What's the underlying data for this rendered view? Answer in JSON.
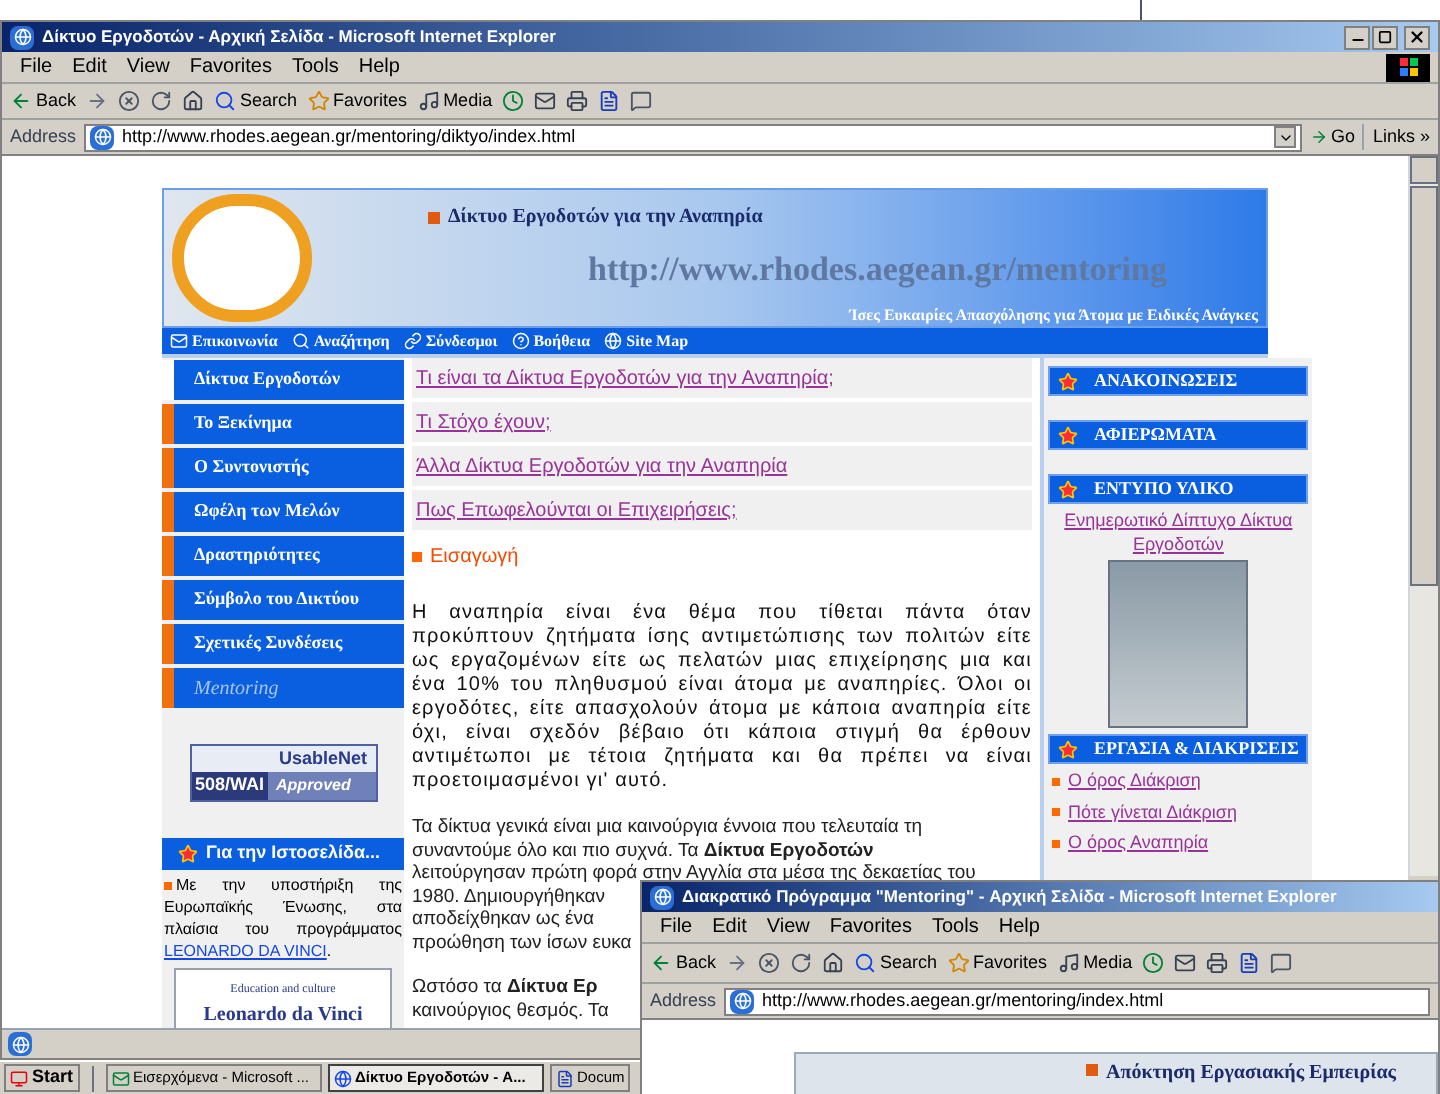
{
  "main_window": {
    "title": "Δίκτυο Εργοδοτών - Αρχική Σελίδα - Microsoft Internet Explorer",
    "menu": [
      "File",
      "Edit",
      "View",
      "Favorites",
      "Tools",
      "Help"
    ],
    "toolbar": [
      {
        "kind": "back",
        "label": "Back"
      },
      {
        "kind": "forward"
      },
      {
        "kind": "stop"
      },
      {
        "kind": "refresh"
      },
      {
        "kind": "home"
      },
      {
        "kind": "search",
        "label": "Search"
      },
      {
        "kind": "favorites",
        "label": "Favorites"
      },
      {
        "kind": "media",
        "label": "Media"
      },
      {
        "kind": "history"
      },
      {
        "kind": "mail"
      },
      {
        "kind": "print"
      },
      {
        "kind": "edit"
      },
      {
        "kind": "discuss"
      }
    ],
    "address": {
      "label": "Address",
      "value": "http://www.rhodes.aegean.gr/mentoring/diktyo/index.html"
    },
    "go": "Go",
    "links": "Links »"
  },
  "page": {
    "header": {
      "title": "Δίκτυο Εργοδοτών για την Αναπηρία",
      "url": "http://www.rhodes.aegean.gr/mentoring",
      "slogan": "Ίσες Ευκαιρίες Απασχόλησης για Άτομα με Ειδικές Ανάγκες"
    },
    "nav": [
      {
        "kind": "mail",
        "label": "Επικοινωνία"
      },
      {
        "kind": "search",
        "label": "Αναζήτηση"
      },
      {
        "kind": "links",
        "label": "Σύνδεσμοι"
      },
      {
        "kind": "help",
        "label": "Βοήθεια"
      },
      {
        "kind": "globe",
        "label": "Site Map"
      }
    ],
    "left_menu": [
      {
        "label": "Δίκτυα Εργοδοτών",
        "selected": true,
        "kind": "normal"
      },
      {
        "label": "Το Ξεκίνημα",
        "selected": false,
        "kind": "normal"
      },
      {
        "label": "Ο Συντονιστής",
        "selected": false,
        "kind": "normal"
      },
      {
        "label": "Ωφέλη των Μελών",
        "selected": false,
        "kind": "normal"
      },
      {
        "label": "Δραστηριότητες",
        "selected": false,
        "kind": "normal"
      },
      {
        "label": "Σύμβολο του Δικτύου",
        "selected": false,
        "kind": "normal"
      },
      {
        "label": "Σχετικές Συνδέσεις",
        "selected": false,
        "kind": "normal"
      },
      {
        "label": "Mentoring",
        "selected": false,
        "kind": "italic"
      }
    ],
    "badge": {
      "top": "UsableNet",
      "bottom": "508/WAI",
      "stamp": "Approved"
    },
    "about": {
      "title": "Για την Ιστοσελίδα...",
      "text": "Με την υποστήριξη της Ευρωπαϊκής Ένωσης, στα πλαίσια του προγράμματος",
      "link": "LEONARDO DA VINCI",
      "end": ".",
      "logo_top": "Education and culture",
      "logo_name": "Leonardo da Vinci"
    },
    "questions": [
      "Τι είναι τα Δίκτυα Εργοδοτών για την Αναπηρία;",
      "Τι Στόχο έχουν;",
      "Άλλα Δίκτυα Εργοδοτών για την Αναπηρία",
      "Πως Επωφελούνται οι Επιχειρήσεις;"
    ],
    "section": "Εισαγωγή",
    "intro": "Η αναπηρία είναι ένα θέμα που τίθεται πάντα όταν προκύπτουν ζητήματα ίσης αντιμετώπισης των πολιτών είτε ως εργαζομένων είτε ως πελατών μιας επιχείρησης μια και ένα 10% του πληθυσμού είναι άτομα με αναπηρίες. Όλοι οι εργοδότες, είτε απασχολούν άτομα με κάποια αναπηρία είτε όχι, είναι σχεδόν βέβαιο ότι κάποια στιγμή θα έρθουν αντιμέτωποι με τέτοια ζητήματα και θα πρέπει να είναι προετοιμασμένοι γι' αυτό.",
    "paragraph_2": [
      "Τα δίκτυα γενικά είναι μια καινούργια έννοια που τελευταία τη",
      "συναντούμε όλο και πιο συχνά. Τα **Δίκτυα Εργοδοτών**",
      "λειτούργησαν πρώτη φορά στην Αγγλία στα μέσα της δεκαετίας του",
      "1980. Δημιουργήθηκαν",
      "αποδείχθηκαν ως ένα",
      "προώθηση των ίσων ευκα"
    ],
    "paragraph_3": [
      "Ωστόσο τα **Δίκτυα Ερ**",
      "καινούργιος θεσμός. Τα"
    ],
    "right": [
      {
        "kind": "header",
        "label": "ΑΝΑΚΟΙΝΩΣΕΙΣ"
      },
      {
        "kind": "header",
        "label": "ΑΦΙΕΡΩΜΑΤΑ"
      },
      {
        "kind": "header",
        "label": "ΕΝΤΥΠΟ ΥΛΙΚΟ"
      },
      {
        "kind": "link",
        "label": "Ενημερωτικό Δίπτυχο Δίκτυα Εργοδοτών"
      },
      {
        "kind": "cover"
      },
      {
        "kind": "header",
        "label": "ΕΡΓΑΣΙΑ & ΔΙΑΚΡΙΣΕΙΣ"
      },
      {
        "kind": "bullet",
        "label": "Ο όρος Διάκριση"
      },
      {
        "kind": "bullet",
        "label": "Πότε γίνεται Διάκριση"
      },
      {
        "kind": "bullet",
        "label": "Ο όρος Αναπηρία"
      }
    ]
  },
  "second_window": {
    "title": "Διακρατικό Πρόγραμμα \"Mentoring\" - Αρχική Σελίδα - Microsoft Internet Explorer",
    "menu": [
      "File",
      "Edit",
      "View",
      "Favorites",
      "Tools",
      "Help"
    ],
    "toolbar": [
      {
        "kind": "back",
        "label": "Back"
      },
      {
        "kind": "forward"
      },
      {
        "kind": "stop"
      },
      {
        "kind": "refresh"
      },
      {
        "kind": "home"
      },
      {
        "kind": "search",
        "label": "Search"
      },
      {
        "kind": "favorites",
        "label": "Favorites"
      },
      {
        "kind": "media",
        "label": "Media"
      },
      {
        "kind": "history"
      },
      {
        "kind": "mail"
      },
      {
        "kind": "print"
      },
      {
        "kind": "edit"
      },
      {
        "kind": "discuss"
      }
    ],
    "address": {
      "label": "Address",
      "value": "http://www.rhodes.aegean.gr/mentoring/index.html"
    },
    "page_heading": "Απόκτηση Εργασιακής Εμπειρίας"
  },
  "taskbar": {
    "start": "Start",
    "tasks": [
      {
        "label": "Εισερχόμενα - Microsoft ...",
        "selected": false,
        "kind": "mail"
      },
      {
        "label": "Δίκτυο Εργοδοτών - A...",
        "selected": true,
        "kind": "browser"
      },
      {
        "label": "Docum",
        "selected": false,
        "kind": "doc"
      }
    ]
  }
}
